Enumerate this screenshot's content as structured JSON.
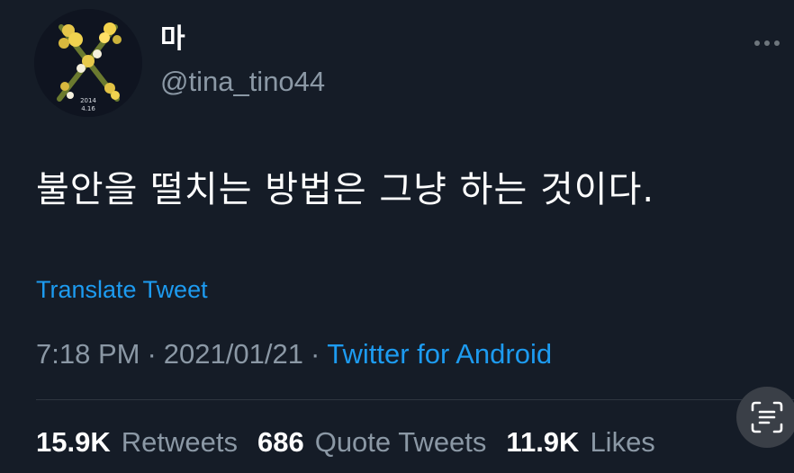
{
  "author": {
    "display_name": "마",
    "handle": "@tina_tino44",
    "avatar_caption_year": "2014",
    "avatar_caption_date": "4.16"
  },
  "tweet": {
    "text": "불안을 떨치는 방법은 그냥 하는 것이다.",
    "translate_label": "Translate Tweet",
    "time": "7:18 PM",
    "separator": "·",
    "date": "2021/01/21",
    "source": "Twitter for Android"
  },
  "stats": {
    "retweets_count": "15.9K",
    "retweets_label": "Retweets",
    "quote_tweets_count": "686",
    "quote_tweets_label": "Quote Tweets",
    "likes_count": "11.9K",
    "likes_label": "Likes"
  },
  "icons": {
    "more": "more-options-icon",
    "scan": "scan-text-icon"
  },
  "colors": {
    "background": "#151c27",
    "link": "#1d9bf0",
    "secondary_text": "#8b98a5",
    "primary_text": "#ffffff"
  }
}
